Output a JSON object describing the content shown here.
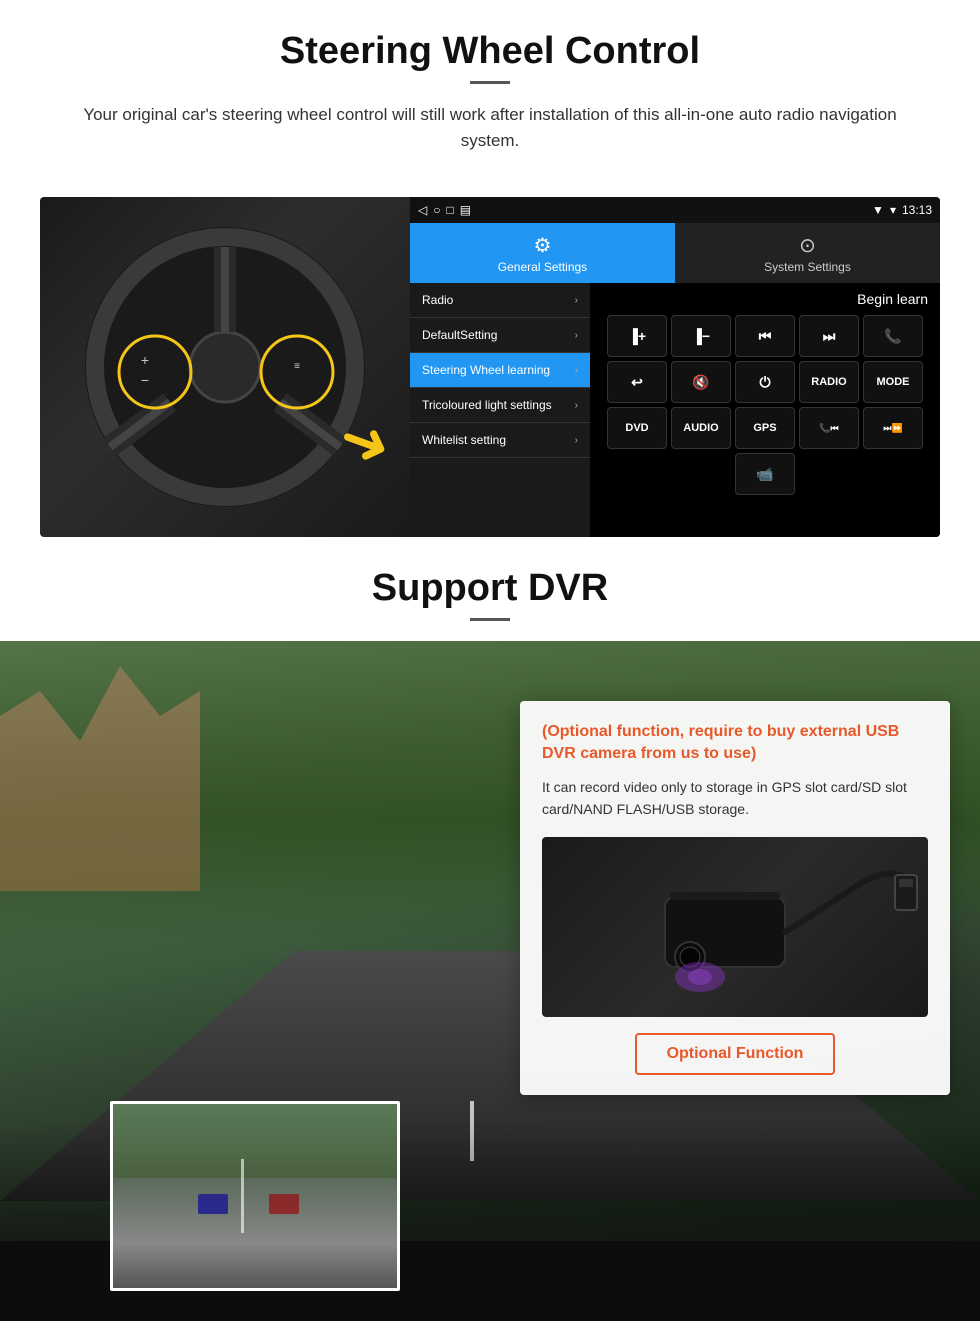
{
  "steering_section": {
    "title": "Steering Wheel Control",
    "description": "Your original car's steering wheel control will still work after installation of this all-in-one auto radio navigation system.",
    "statusbar": {
      "time": "13:13",
      "signal": "▼",
      "wifi": "▾"
    },
    "tabs": {
      "general": {
        "icon": "⚙",
        "label": "General Settings"
      },
      "system": {
        "icon": "🌐",
        "label": "System Settings"
      }
    },
    "menu_items": [
      {
        "label": "Radio",
        "active": false
      },
      {
        "label": "DefaultSetting",
        "active": false
      },
      {
        "label": "Steering Wheel learning",
        "active": true
      },
      {
        "label": "Tricoloured light settings",
        "active": false
      },
      {
        "label": "Whitelist setting",
        "active": false
      }
    ],
    "begin_learn": "Begin learn",
    "control_buttons": [
      [
        "vol+",
        "vol-",
        "⏮",
        "⏭",
        "📞"
      ],
      [
        "↩",
        "🔇",
        "⏻",
        "RADIO",
        "MODE"
      ],
      [
        "DVD",
        "AUDIO",
        "GPS",
        "📞⏮",
        "⏭⏩"
      ]
    ]
  },
  "dvr_section": {
    "title": "Support DVR",
    "optional_title": "(Optional function, require to buy external USB DVR camera from us to use)",
    "description": "It can record video only to storage in GPS slot card/SD slot card/NAND FLASH/USB storage.",
    "optional_button_label": "Optional Function"
  }
}
